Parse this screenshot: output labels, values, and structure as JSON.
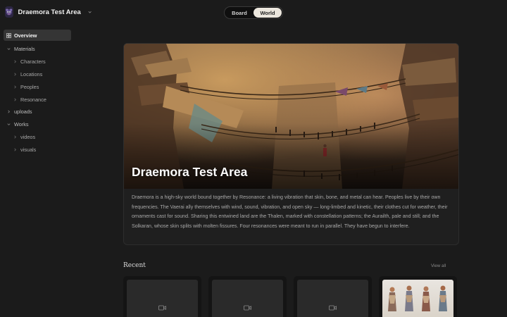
{
  "workspace": {
    "name": "Draemora Test Area",
    "avatar_icon": "creature-avatar-icon",
    "accent_color": "#2c2642"
  },
  "view_toggle": {
    "options": [
      "Board",
      "World"
    ],
    "selected": "World"
  },
  "sidebar": {
    "items": [
      {
        "label": "Overview",
        "level": 0,
        "active": true,
        "icon": "grid-icon"
      },
      {
        "label": "Materials",
        "level": 0,
        "expanded": true
      },
      {
        "label": "Characters",
        "level": 1
      },
      {
        "label": "Locations",
        "level": 1
      },
      {
        "label": "Peoples",
        "level": 1
      },
      {
        "label": "Resonance",
        "level": 1
      },
      {
        "label": "uploads",
        "level": 0
      },
      {
        "label": "Works",
        "level": 0,
        "expanded": true
      },
      {
        "label": "videos",
        "level": 1
      },
      {
        "label": "visuals",
        "level": 1
      }
    ]
  },
  "hero": {
    "title": "Draemora Test Area",
    "description": "Draemora is a high-sky world bound together by Resonance: a living vibration that skin, bone, and metal can hear. Peoples live by their own frequencies. The Vaerai ally themselves with wind, sound, vibration, and open sky — long-limbed and kinetic, their clothes cut for weather, their ornaments cast for sound. Sharing this entwined land are the Thalen, marked with constellation patterns; the Aurailth, pale and still; and the Solkaran, whose skin splits with molten fissures. Four resonances were meant to run in parallel. They have begun to interfere."
  },
  "recent": {
    "title": "Recent",
    "view_all": "View all",
    "items": [
      {
        "type": "video",
        "icon": "video-camera-icon"
      },
      {
        "type": "video",
        "icon": "video-camera-icon"
      },
      {
        "type": "video",
        "icon": "video-camera-icon"
      },
      {
        "type": "image",
        "icon": "character-lineup-image"
      }
    ]
  }
}
